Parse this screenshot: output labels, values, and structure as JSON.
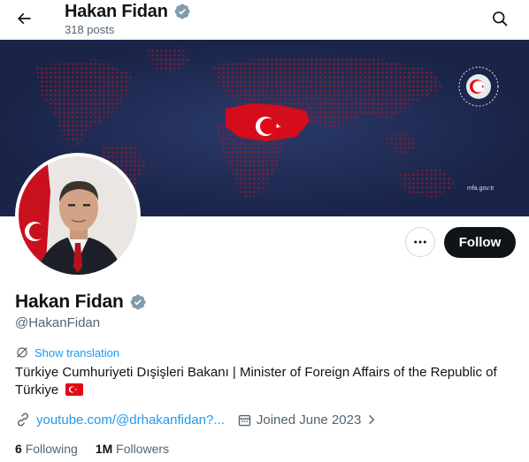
{
  "header": {
    "title": "Hakan Fidan",
    "post_count": "318 posts"
  },
  "banner": {
    "caption": "mfa.gov.tr",
    "background_color": "#1e2a52",
    "map_color": "#8b1d2c",
    "flag_color": "#e30a17"
  },
  "profile": {
    "display_name": "Hakan Fidan",
    "handle": "@HakanFidan",
    "verified_color": "#829aab",
    "show_translation_label": "Show translation",
    "bio": "Türkiye Cumhuriyeti Dışişleri Bakanı | Minister of Foreign Affairs of the Republic of Türkiye",
    "link_text": "youtube.com/@drhakanfidan?...",
    "joined_text": "Joined June 2023",
    "following_count": "6",
    "following_label": "Following",
    "followers_count": "1M",
    "followers_label": "Followers"
  },
  "actions": {
    "follow_label": "Follow"
  },
  "icons": {
    "back": "arrow-left-icon",
    "search": "search-icon",
    "more": "more-icon",
    "verified": "verified-badge-icon",
    "translate": "translate-icon",
    "link": "link-icon",
    "calendar": "calendar-icon",
    "chevron": "chevron-right-icon"
  }
}
